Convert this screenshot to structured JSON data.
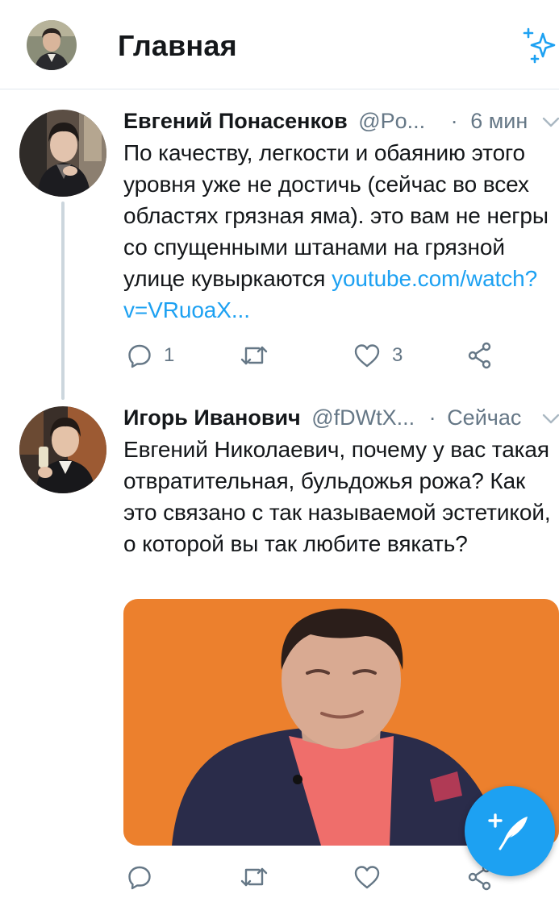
{
  "header": {
    "title": "Главная"
  },
  "tweets": [
    {
      "author_name": "Евгений Понасенков",
      "handle": "@Po...",
      "separator": "·",
      "time": "6 мин",
      "text": "По качеству, легкости и обаянию этого уровня уже не достичь (сейчас во всех областях грязная яма). это вам не негры со спущенными штанами на грязной улице кувыркаются ",
      "link": "youtube.com/watch?v=VRuoaX...",
      "reply_count": "1",
      "retweet_count": "",
      "like_count": "3"
    },
    {
      "author_name": "Игорь Иванович",
      "handle": "@fDWtX...",
      "separator": "·",
      "time": "Сейчас",
      "text": "Евгений Николаевич, почему у вас такая отвратительная, бульдожья рожа? Как это связано с так называемой эстетикой, о которой вы так любите вякать?",
      "reply_count": "",
      "retweet_count": "",
      "like_count": ""
    }
  ],
  "colors": {
    "accent": "#1da1f2",
    "text_primary": "#14171a",
    "text_secondary": "#657786",
    "divider": "#e1e8ed",
    "thread_line": "#ccd6dd",
    "media_background": "#ea7c2a"
  },
  "icons": {
    "header_action": "sparkle-icon",
    "reply": "reply-icon",
    "retweet": "retweet-icon",
    "like": "heart-icon",
    "share": "share-icon",
    "caret": "chevron-down-icon",
    "compose": "compose-tweet-icon"
  }
}
